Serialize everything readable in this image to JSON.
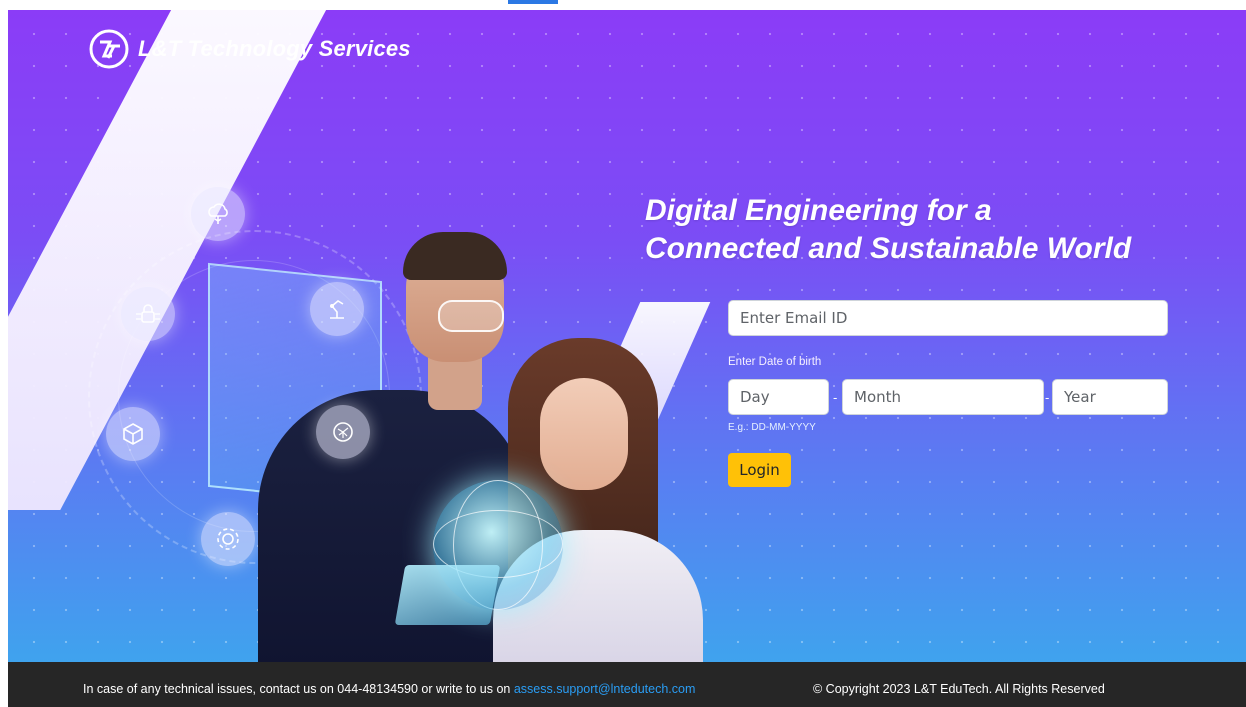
{
  "brand": {
    "name": "L&T Technology Services"
  },
  "hero": {
    "heading_line1": "Digital Engineering for a",
    "heading_line2": "Connected and Sustainable World"
  },
  "form": {
    "email_placeholder": "Enter Email ID",
    "dob_label": "Enter Date of birth",
    "day_placeholder": "Day",
    "month_placeholder": "Month",
    "year_placeholder": "Year",
    "separator": "-",
    "dob_hint": "E.g.: DD-MM-YYYY",
    "login_label": "Login"
  },
  "footer": {
    "support_text": "In case of any technical issues, contact us on 044-48134590 or write to us on",
    "support_email": "assess.support@lntedutech.com",
    "copyright": "© Copyright 2023 L&T EduTech. All Rights Reserved"
  },
  "icons": {
    "brand_logo": "lt-logo-icon",
    "bubbles": [
      "cloud-tree-icon",
      "lock-circuit-icon",
      "cube-icon",
      "gear-icon",
      "robot-arm-icon",
      "brain-circuit-icon"
    ]
  },
  "colors": {
    "gradient_top": "#8b3cf7",
    "gradient_bottom": "#3fa3ee",
    "login_button": "#ffc107",
    "footer_bg": "#262626",
    "link": "#2a9df4"
  }
}
